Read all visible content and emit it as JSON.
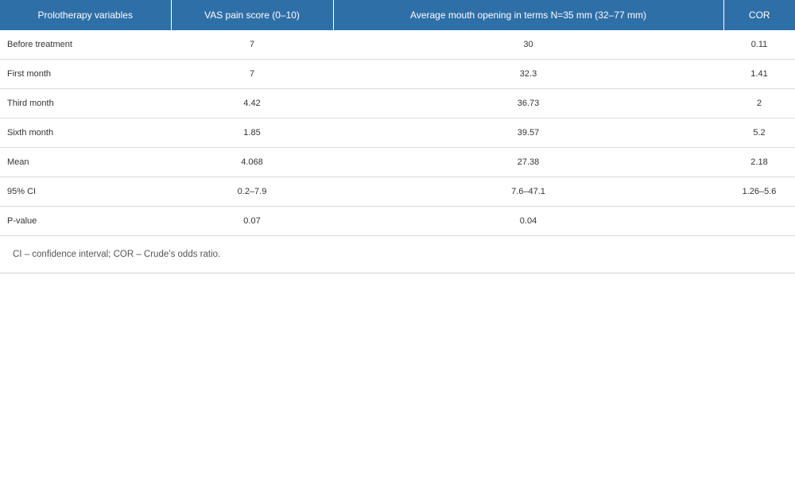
{
  "table": {
    "headers": [
      "Prolotherapy variables",
      "VAS pain score (0–10)",
      "Average mouth opening in terms N=35 mm (32–77 mm)",
      "COR"
    ],
    "rows": [
      [
        "Before treatment",
        "7",
        "30",
        "0.11"
      ],
      [
        "First month",
        "7",
        "32.3",
        "1.41"
      ],
      [
        "Third month",
        "4.42",
        "36.73",
        "2"
      ],
      [
        "Sixth month",
        "1.85",
        "39.57",
        "5.2"
      ],
      [
        "Mean",
        "4.068",
        "27.38",
        "2.18"
      ],
      [
        "95% CI",
        "0.2–7.9",
        "7.6–47.1",
        "1.26–5.6"
      ],
      [
        "P-value",
        "0.07",
        "0.04",
        ""
      ]
    ],
    "footnote": "CI – confidence interval; COR – Crude’s odds ratio.",
    "colors": {
      "header_bg": "#2f6fa8",
      "header_text": "#ffffff"
    }
  }
}
